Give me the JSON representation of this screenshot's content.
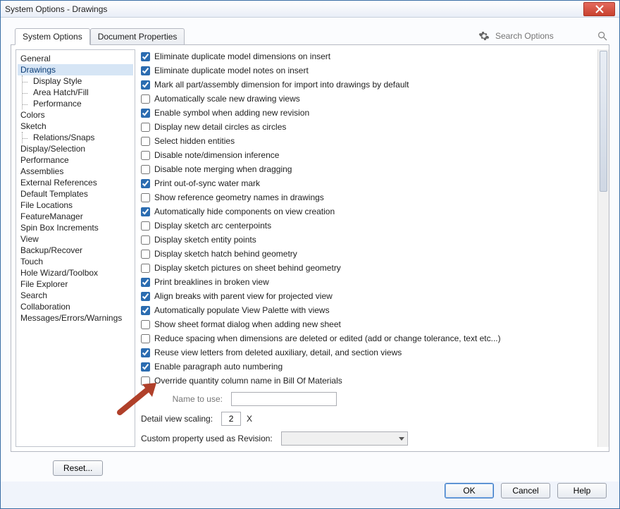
{
  "window": {
    "title": "System Options - Drawings"
  },
  "tabs": {
    "system_options": "System Options",
    "document_properties": "Document Properties"
  },
  "search": {
    "placeholder": "Search Options"
  },
  "categories": [
    "General",
    "Drawings",
    [
      "Display Style",
      "Area Hatch/Fill",
      "Performance"
    ],
    "Colors",
    "Sketch",
    [
      "Relations/Snaps"
    ],
    "Display/Selection",
    "Performance",
    "Assemblies",
    "External References",
    "Default Templates",
    "File Locations",
    "FeatureManager",
    "Spin Box Increments",
    "View",
    "Backup/Recover",
    "Touch",
    "Hole Wizard/Toolbox",
    "File Explorer",
    "Search",
    "Collaboration",
    "Messages/Errors/Warnings"
  ],
  "selected_category": "Drawings",
  "options": [
    {
      "checked": true,
      "label": "Eliminate duplicate model dimensions on insert"
    },
    {
      "checked": true,
      "label": "Eliminate duplicate model notes on insert"
    },
    {
      "checked": true,
      "label": "Mark all part/assembly dimension for import into drawings by default"
    },
    {
      "checked": false,
      "label": "Automatically scale new drawing views"
    },
    {
      "checked": true,
      "label": "Enable symbol when adding new revision"
    },
    {
      "checked": false,
      "label": "Display new detail circles as circles"
    },
    {
      "checked": false,
      "label": "Select hidden entities"
    },
    {
      "checked": false,
      "label": "Disable note/dimension inference"
    },
    {
      "checked": false,
      "label": "Disable note merging when dragging"
    },
    {
      "checked": true,
      "label": "Print out-of-sync water mark"
    },
    {
      "checked": false,
      "label": "Show reference geometry names in drawings"
    },
    {
      "checked": true,
      "label": "Automatically hide components on view creation"
    },
    {
      "checked": false,
      "label": "Display sketch arc centerpoints"
    },
    {
      "checked": false,
      "label": "Display sketch entity points"
    },
    {
      "checked": false,
      "label": "Display sketch hatch behind geometry"
    },
    {
      "checked": false,
      "label": "Display sketch pictures on sheet behind geometry"
    },
    {
      "checked": true,
      "label": "Print breaklines in broken view"
    },
    {
      "checked": true,
      "label": "Align breaks with parent view for projected view"
    },
    {
      "checked": true,
      "label": "Automatically populate View Palette with views"
    },
    {
      "checked": false,
      "label": "Show sheet format dialog when adding new sheet"
    },
    {
      "checked": false,
      "label": "Reduce spacing when dimensions are deleted or edited (add or change tolerance, text etc...)"
    },
    {
      "checked": true,
      "label": "Reuse view letters from deleted auxiliary, detail, and section views"
    },
    {
      "checked": true,
      "label": "Enable paragraph auto numbering"
    },
    {
      "checked": false,
      "label": "Override quantity column name in Bill Of Materials"
    }
  ],
  "fields": {
    "name_to_use_label": "Name to use:",
    "name_to_use_value": "",
    "detail_scaling_label": "Detail view scaling:",
    "detail_scaling_value": "2",
    "detail_scaling_suffix": "X",
    "custom_prop_label": "Custom property used as Revision:",
    "custom_prop_value": ""
  },
  "buttons": {
    "reset": "Reset...",
    "ok": "OK",
    "cancel": "Cancel",
    "help": "Help"
  }
}
